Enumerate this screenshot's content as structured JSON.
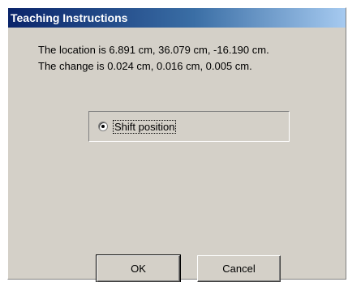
{
  "window": {
    "title": "Teaching Instructions"
  },
  "message": {
    "line1": "The location is 6.891 cm, 36.079 cm, -16.190 cm.",
    "line2": "The change is 0.024 cm, 0.016 cm, 0.005 cm."
  },
  "option": {
    "label": "Shift position",
    "selected": true
  },
  "buttons": {
    "ok_label": "OK",
    "cancel_label": "Cancel"
  },
  "colors": {
    "title_gradient_start": "#0a246a",
    "title_gradient_end": "#a6caf0",
    "dialog_bg": "#d4d0c8"
  }
}
